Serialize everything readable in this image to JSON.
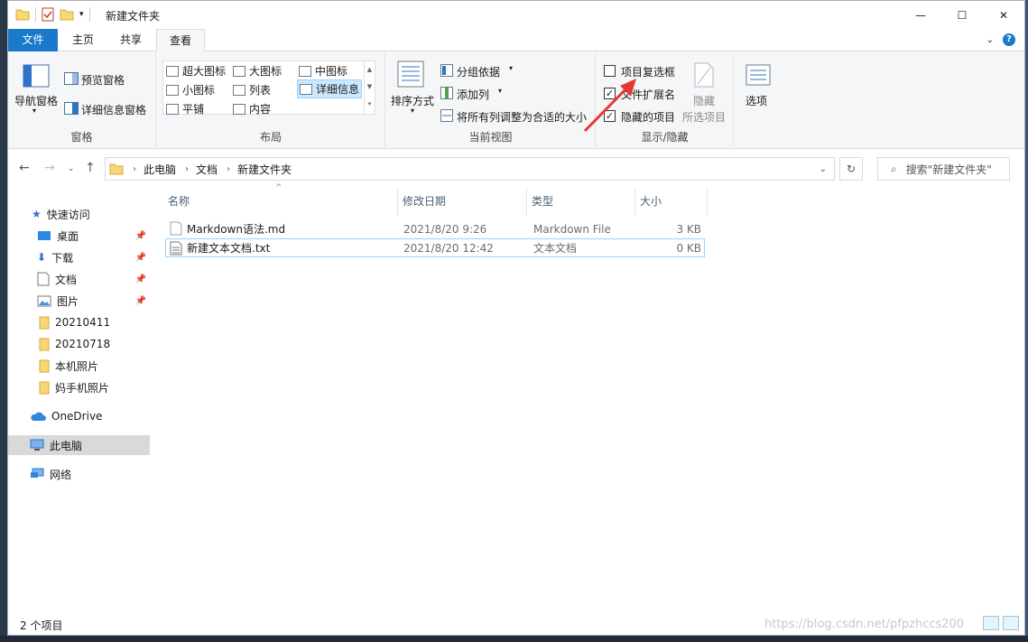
{
  "window": {
    "title": "新建文件夹",
    "controls": {
      "minimize": "—",
      "maximize": "☐",
      "close": "✕"
    }
  },
  "tabs": [
    {
      "label": "文件"
    },
    {
      "label": "主页"
    },
    {
      "label": "共享"
    },
    {
      "label": "查看"
    }
  ],
  "ribbon": {
    "panes": {
      "group_label": "窗格",
      "nav_pane": "导航窗格",
      "preview": "预览窗格",
      "details": "详细信息窗格"
    },
    "layout": {
      "group_label": "布局",
      "items": [
        "超大图标",
        "大图标",
        "中图标",
        "小图标",
        "列表",
        "详细信息",
        "平铺",
        "内容"
      ],
      "selected": "详细信息"
    },
    "current_view": {
      "group_label": "当前视图",
      "sort": "排序方式",
      "group_by": "分组依据",
      "add_column": "添加列",
      "fit_columns": "将所有列调整为合适的大小"
    },
    "show_hide": {
      "group_label": "显示/隐藏",
      "item_checkboxes": {
        "label": "项目复选框",
        "checked": false
      },
      "file_extensions": {
        "label": "文件扩展名",
        "checked": true
      },
      "hidden_items": {
        "label": "隐藏的项目",
        "checked": true
      },
      "hide_selected_line1": "隐藏",
      "hide_selected_line2": "所选项目"
    },
    "options": "选项"
  },
  "address": {
    "crumbs": [
      "此电脑",
      "文档",
      "新建文件夹"
    ],
    "search_placeholder": "搜索\"新建文件夹\""
  },
  "navpane": {
    "quick_access": "快速访问",
    "items": [
      {
        "label": "桌面",
        "pinned": true
      },
      {
        "label": "下载",
        "pinned": true
      },
      {
        "label": "文档",
        "pinned": true
      },
      {
        "label": "图片",
        "pinned": true
      },
      {
        "label": "20210411",
        "pinned": false
      },
      {
        "label": "20210718",
        "pinned": false
      },
      {
        "label": "本机照片",
        "pinned": false
      },
      {
        "label": "妈手机照片",
        "pinned": false
      }
    ],
    "onedrive": "OneDrive",
    "this_pc": "此电脑",
    "network": "网络"
  },
  "filelist": {
    "columns": {
      "name": "名称",
      "modified": "修改日期",
      "type": "类型",
      "size": "大小"
    },
    "rows": [
      {
        "name": "Markdown语法.md",
        "modified": "2021/8/20 9:26",
        "type": "Markdown File",
        "size": "3 KB"
      },
      {
        "name": "新建文本文档.txt",
        "modified": "2021/8/20 12:42",
        "type": "文本文档",
        "size": "0 KB"
      }
    ]
  },
  "status": {
    "count": "2 个项目",
    "watermark": "https://blog.csdn.net/pfpzhccs200"
  }
}
